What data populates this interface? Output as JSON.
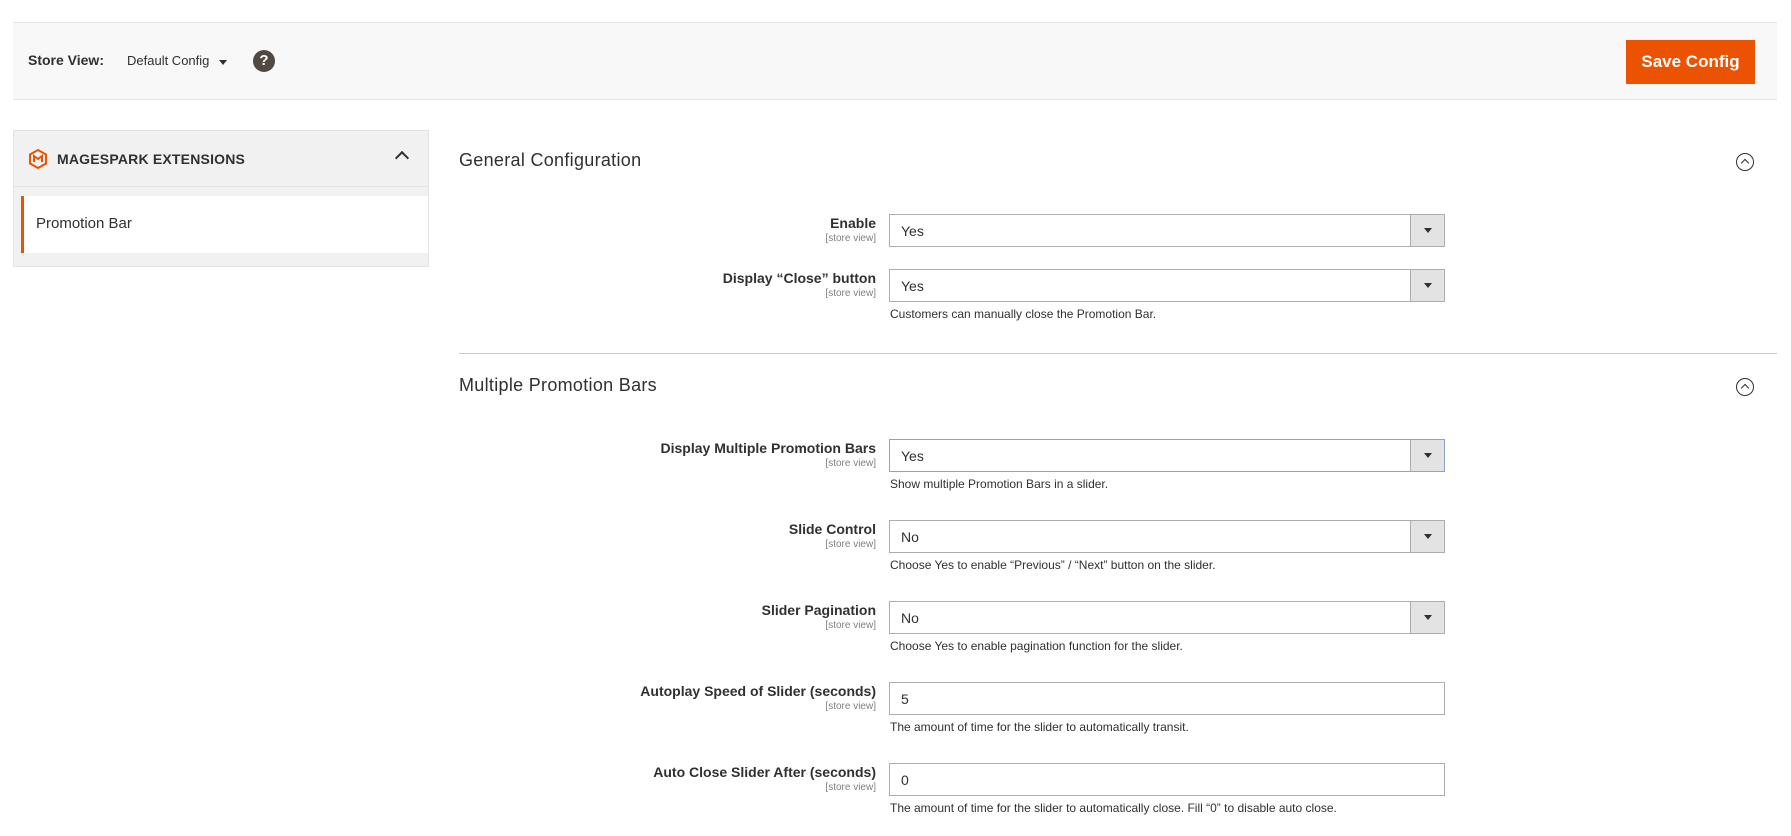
{
  "store_bar": {
    "label": "Store View:",
    "value": "Default Config",
    "save_label": "Save Config"
  },
  "sidebar": {
    "title": "MAGESPARK EXTENSIONS",
    "items": [
      {
        "label": "Promotion Bar",
        "active": true
      }
    ]
  },
  "sections": {
    "general": {
      "title": "General Configuration",
      "fields": {
        "enable": {
          "label": "Enable",
          "scope": "[store view]",
          "value": "Yes"
        },
        "close_button": {
          "label": "Display “Close” button",
          "scope": "[store view]",
          "value": "Yes",
          "note": "Customers can manually close the Promotion Bar."
        }
      }
    },
    "multiple": {
      "title": "Multiple Promotion Bars",
      "fields": {
        "display_multiple": {
          "label": "Display Multiple Promotion Bars",
          "scope": "[store view]",
          "value": "Yes",
          "note": "Show multiple Promotion Bars in a slider."
        },
        "slide_control": {
          "label": "Slide Control",
          "scope": "[store view]",
          "value": "No",
          "note": "Choose Yes to enable “Previous” / “Next” button on the slider."
        },
        "slider_pagination": {
          "label": "Slider Pagination",
          "scope": "[store view]",
          "value": "No",
          "note": "Choose Yes to enable pagination function for the slider."
        },
        "autoplay_speed": {
          "label": "Autoplay Speed of Slider (seconds)",
          "scope": "[store view]",
          "value": "5",
          "note": "The amount of time for the slider to automatically transit."
        },
        "auto_close": {
          "label": "Auto Close Slider After (seconds)",
          "scope": "[store view]",
          "value": "0",
          "note": "The amount of time for the slider to automatically close. Fill “0” to disable auto close."
        }
      }
    }
  },
  "colors": {
    "accent": "#eb5202",
    "help_icon_bg": "#514943"
  }
}
